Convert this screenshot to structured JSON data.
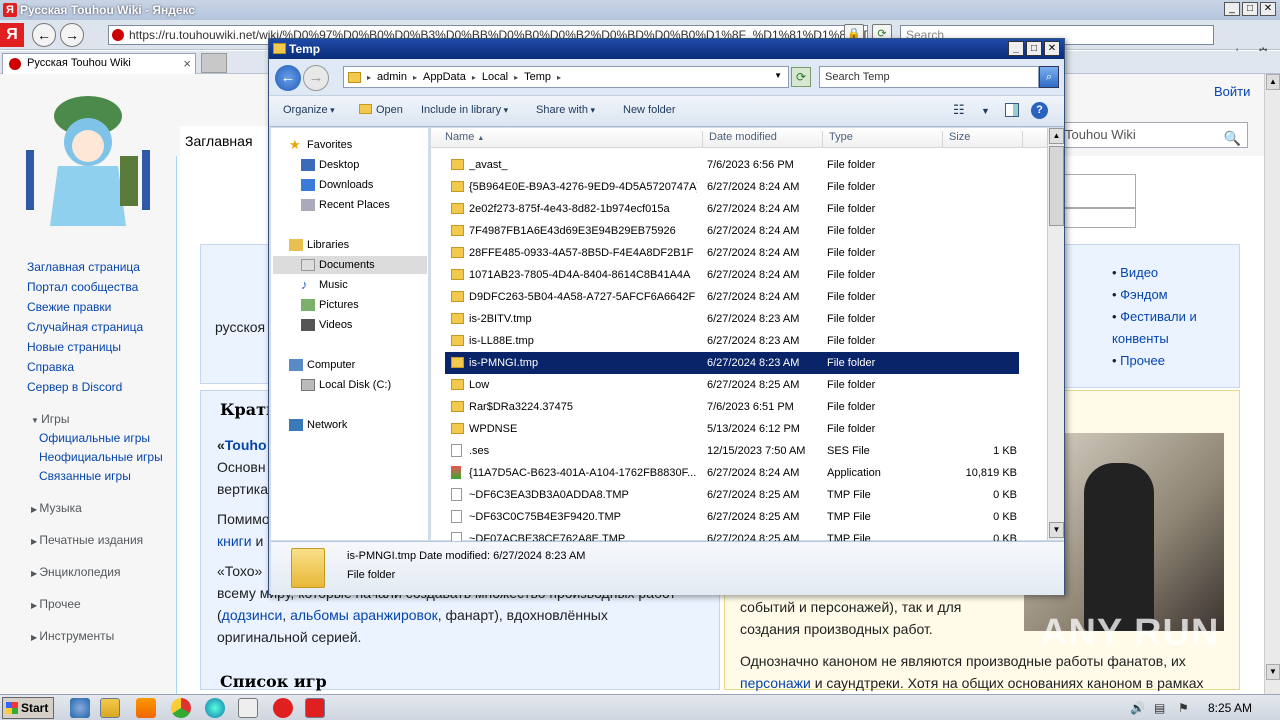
{
  "browser": {
    "title": "Русская Touhou Wiki - Яндекс",
    "yandex_letter": "Я",
    "address": "https://ru.touhouwiki.net/wiki/%D0%97%D0%B0%D0%B3%D0%BB%D0%B0%D0%B2%D0%BD%D0%B0%D1%8F_%D1%81%D1%82%D1%80%D0",
    "search_placeholder": "Search",
    "tab_label": "Русская Touhou Wiki"
  },
  "wiki": {
    "login": "Войти",
    "main_tab": "Заглавная",
    "search_text": "Touhou Wiki",
    "sidebar_nav": [
      "Заглавная страница",
      "Портал сообщества",
      "Свежие правки",
      "Случайная страница",
      "Новые страницы",
      "Справка",
      "Сервер в Discord"
    ],
    "sections": {
      "games": "Игры",
      "games_sub": [
        "Официальные игры",
        "Неофициальные игры",
        "Связанные игры"
      ],
      "music": "Музыка",
      "print": "Печатные издания",
      "encyclopedia": "Энциклопедия",
      "other": "Прочее",
      "tools": "Инструменты"
    },
    "bullets": [
      "Видео",
      "Фэндом",
      "Фестивали и конвенты",
      "Прочее"
    ],
    "text_ruska": "русскоя",
    "heading_brief": "Кратк",
    "quote_start": "«",
    "quote_link": "Touho",
    "line_basic": "Основн",
    "line_vert": "вертика",
    "line_pomimo": "Помимо",
    "line_books_link": "книги",
    "line_books_tail": " и",
    "line_toho": "«Тохо»",
    "line_world": "всему миру, которые начали создавать множество производных работ",
    "line_doujin_open": "(",
    "line_doujin": "додзинси",
    "line_comma": ", ",
    "line_albums": "альбомы аранжировок",
    "line_fanart": ", фанарт), вдохновлённых",
    "line_original": "оригинальной серией.",
    "heading_games": "Список игр",
    "right_line1": "событий и персонажей), так и для",
    "right_line2": "создания производных работ.",
    "right_line3": "Однозначно каноном не являются производные работы фанатов, их",
    "right_link": "персонажи",
    "right_line4": " и саундтреки. Хотя на общих основаниях каноном в рамках"
  },
  "explorer": {
    "title": "Temp",
    "breadcrumb": [
      "admin",
      "AppData",
      "Local",
      "Temp"
    ],
    "search_placeholder": "Search Temp",
    "toolbar": {
      "organize": "Organize",
      "open": "Open",
      "include": "Include in library",
      "share": "Share with",
      "new_folder": "New folder"
    },
    "nav": {
      "favorites": "Favorites",
      "desktop": "Desktop",
      "downloads": "Downloads",
      "recent": "Recent Places",
      "libraries": "Libraries",
      "documents": "Documents",
      "music": "Music",
      "pictures": "Pictures",
      "videos": "Videos",
      "computer": "Computer",
      "local_disk": "Local Disk (C:)",
      "network": "Network"
    },
    "columns": {
      "name": "Name",
      "date": "Date modified",
      "type": "Type",
      "size": "Size"
    },
    "files": [
      {
        "name": "_avast_",
        "date": "7/6/2023 6:56 PM",
        "type": "File folder",
        "size": "",
        "icon": "folder"
      },
      {
        "name": "{5B964E0E-B9A3-4276-9ED9-4D5A5720747A}",
        "date": "6/27/2024 8:24 AM",
        "type": "File folder",
        "size": "",
        "icon": "folder"
      },
      {
        "name": "2e02f273-875f-4e43-8d82-1b974ecf015a",
        "date": "6/27/2024 8:24 AM",
        "type": "File folder",
        "size": "",
        "icon": "folder"
      },
      {
        "name": "7F4987FB1A6E43d69E3E94B29EB75926",
        "date": "6/27/2024 8:24 AM",
        "type": "File folder",
        "size": "",
        "icon": "folder"
      },
      {
        "name": "28FFE485-0933-4A57-8B5D-F4E4A8DF2B1F",
        "date": "6/27/2024 8:24 AM",
        "type": "File folder",
        "size": "",
        "icon": "folder"
      },
      {
        "name": "1071AB23-7805-4D4A-8404-8614C8B41A4A",
        "date": "6/27/2024 8:24 AM",
        "type": "File folder",
        "size": "",
        "icon": "folder"
      },
      {
        "name": "D9DFC263-5B04-4A58-A727-5AFCF6A6642F",
        "date": "6/27/2024 8:24 AM",
        "type": "File folder",
        "size": "",
        "icon": "folder"
      },
      {
        "name": "is-2BITV.tmp",
        "date": "6/27/2024 8:23 AM",
        "type": "File folder",
        "size": "",
        "icon": "folder"
      },
      {
        "name": "is-LL88E.tmp",
        "date": "6/27/2024 8:23 AM",
        "type": "File folder",
        "size": "",
        "icon": "folder"
      },
      {
        "name": "is-PMNGI.tmp",
        "date": "6/27/2024 8:23 AM",
        "type": "File folder",
        "size": "",
        "icon": "folder",
        "selected": true
      },
      {
        "name": "Low",
        "date": "6/27/2024 8:25 AM",
        "type": "File folder",
        "size": "",
        "icon": "folder"
      },
      {
        "name": "Rar$DRa3224.37475",
        "date": "7/6/2023 6:51 PM",
        "type": "File folder",
        "size": "",
        "icon": "folder"
      },
      {
        "name": "WPDNSE",
        "date": "5/13/2024 6:12 PM",
        "type": "File folder",
        "size": "",
        "icon": "folder"
      },
      {
        "name": ".ses",
        "date": "12/15/2023 7:50 AM",
        "type": "SES File",
        "size": "1 KB",
        "icon": "file"
      },
      {
        "name": "{11A7D5AC-B623-401A-A104-1762FB8830F...",
        "date": "6/27/2024 8:24 AM",
        "type": "Application",
        "size": "10,819 KB",
        "icon": "app"
      },
      {
        "name": "~DF6C3EA3DB3A0ADDA8.TMP",
        "date": "6/27/2024 8:25 AM",
        "type": "TMP File",
        "size": "0 KB",
        "icon": "file"
      },
      {
        "name": "~DF63C0C75B4E3F9420.TMP",
        "date": "6/27/2024 8:25 AM",
        "type": "TMP File",
        "size": "0 KB",
        "icon": "file"
      },
      {
        "name": "~DF07ACBE38CE762A8E.TMP",
        "date": "6/27/2024 8:25 AM",
        "type": "TMP File",
        "size": "0 KB",
        "icon": "file"
      }
    ],
    "details": {
      "name": "is-PMNGI.tmp",
      "modified": "Date modified: 6/27/2024 8:23 AM",
      "type": "File folder"
    }
  },
  "taskbar": {
    "start": "Start",
    "clock": "8:25 AM"
  },
  "watermark": "ANY RUN"
}
